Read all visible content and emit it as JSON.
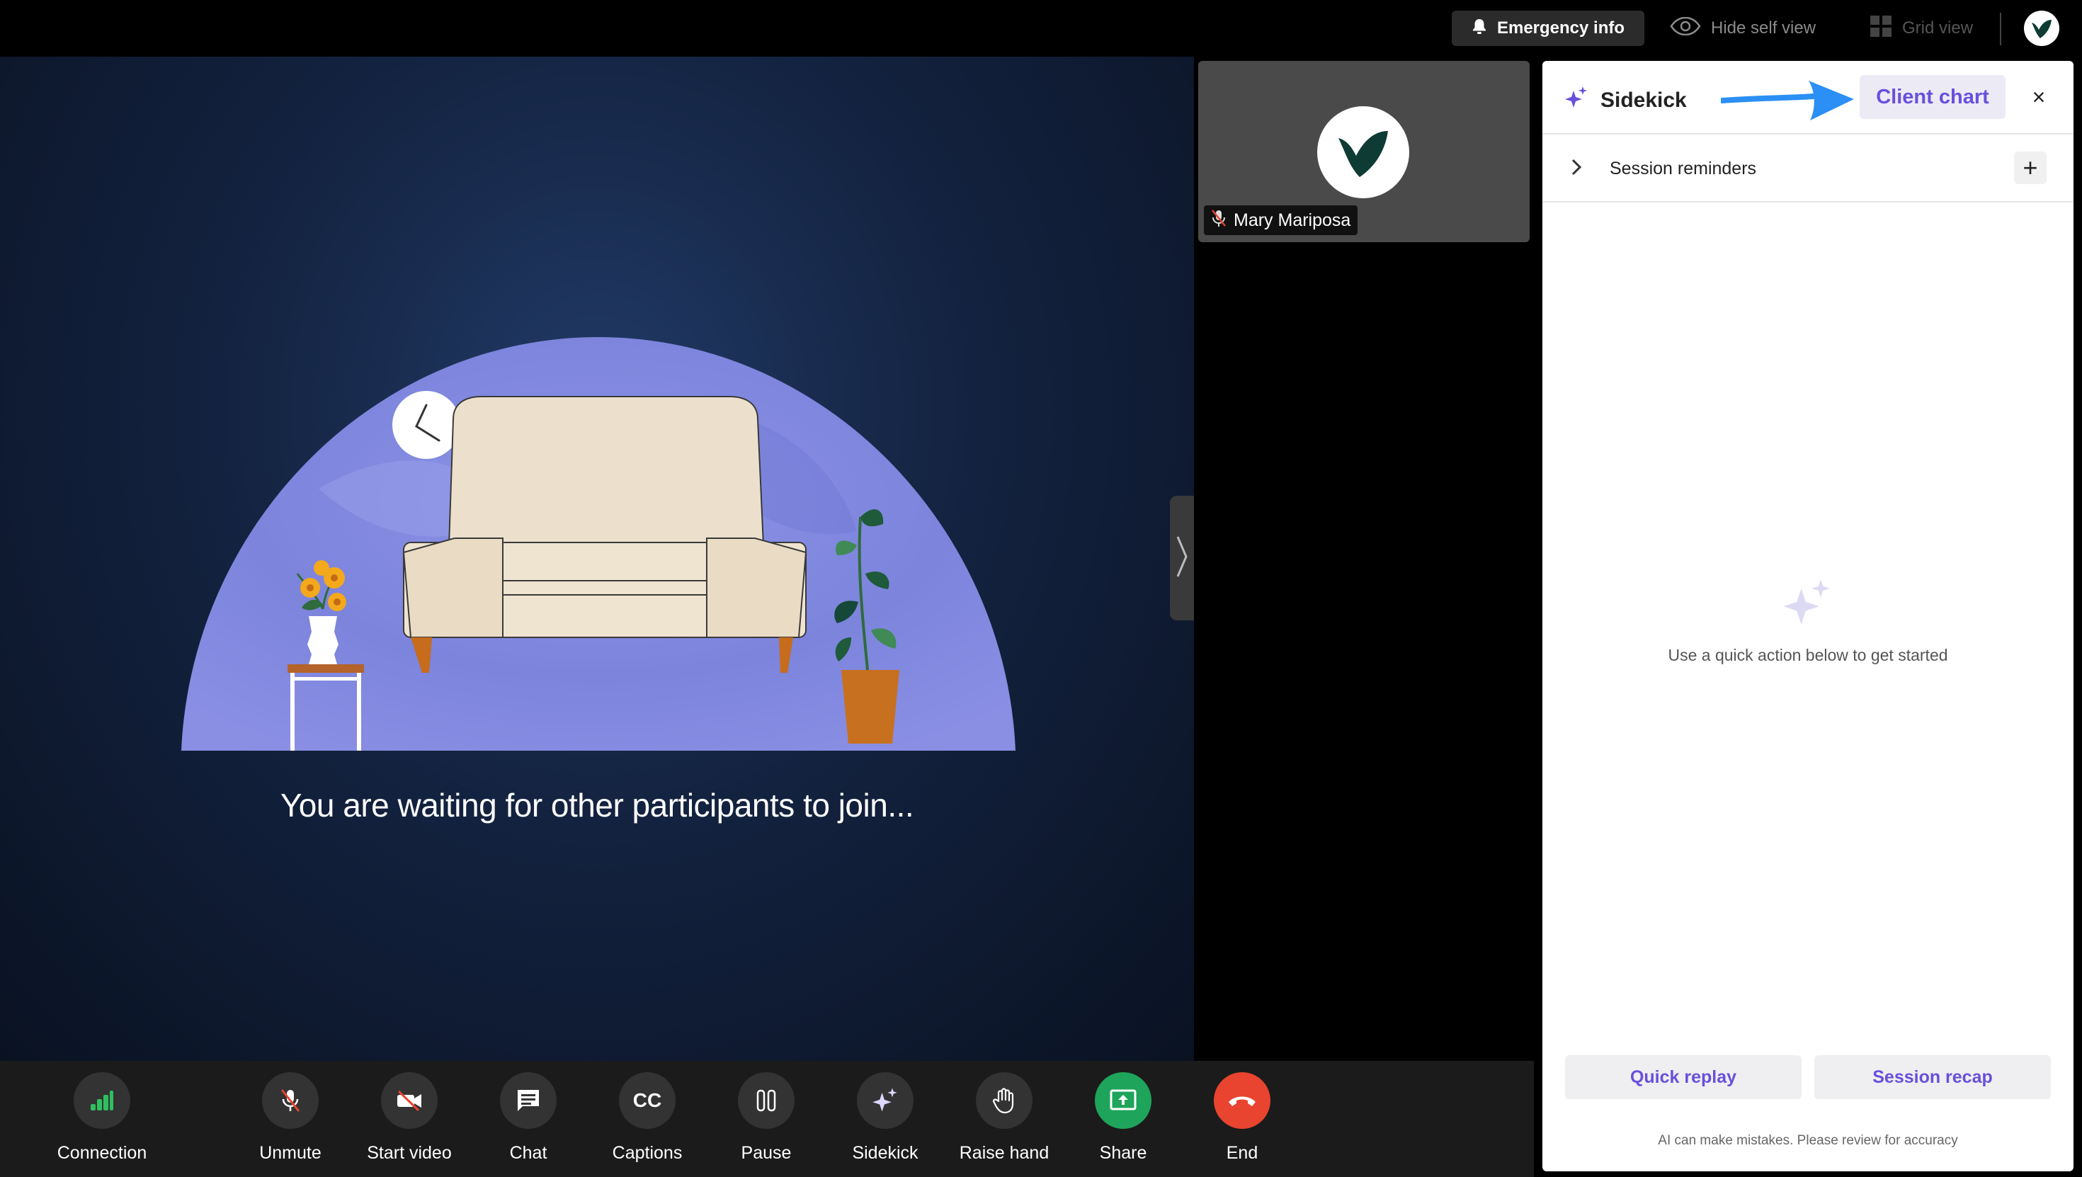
{
  "topbar": {
    "emergency_label": "Emergency info",
    "hide_self_label": "Hide self view",
    "grid_view_label": "Grid view"
  },
  "stage": {
    "waiting_message": "You are waiting for other participants to join..."
  },
  "self_view": {
    "participant_name": "Mary Mariposa"
  },
  "sidekick": {
    "title": "Sidekick",
    "client_chart_label": "Client chart",
    "close_label": "×",
    "reminders_label": "Session reminders",
    "add_label": "+",
    "empty_message": "Use a quick action below to get started",
    "quick_replay_label": "Quick replay",
    "session_recap_label": "Session recap",
    "disclaimer": "AI can make mistakes. Please review for accuracy"
  },
  "toolbar": {
    "connection": "Connection",
    "unmute": "Unmute",
    "start_video": "Start video",
    "chat": "Chat",
    "captions": "Captions",
    "captions_icon_text": "CC",
    "pause": "Pause",
    "sidekick": "Sidekick",
    "raise_hand": "Raise hand",
    "share": "Share",
    "end": "End"
  },
  "colors": {
    "accent_purple": "#6a4fdc",
    "share_green": "#1fa45b",
    "end_red": "#e8442f",
    "connection_green": "#2fbf5f",
    "arrow_blue": "#2b8ff5"
  }
}
